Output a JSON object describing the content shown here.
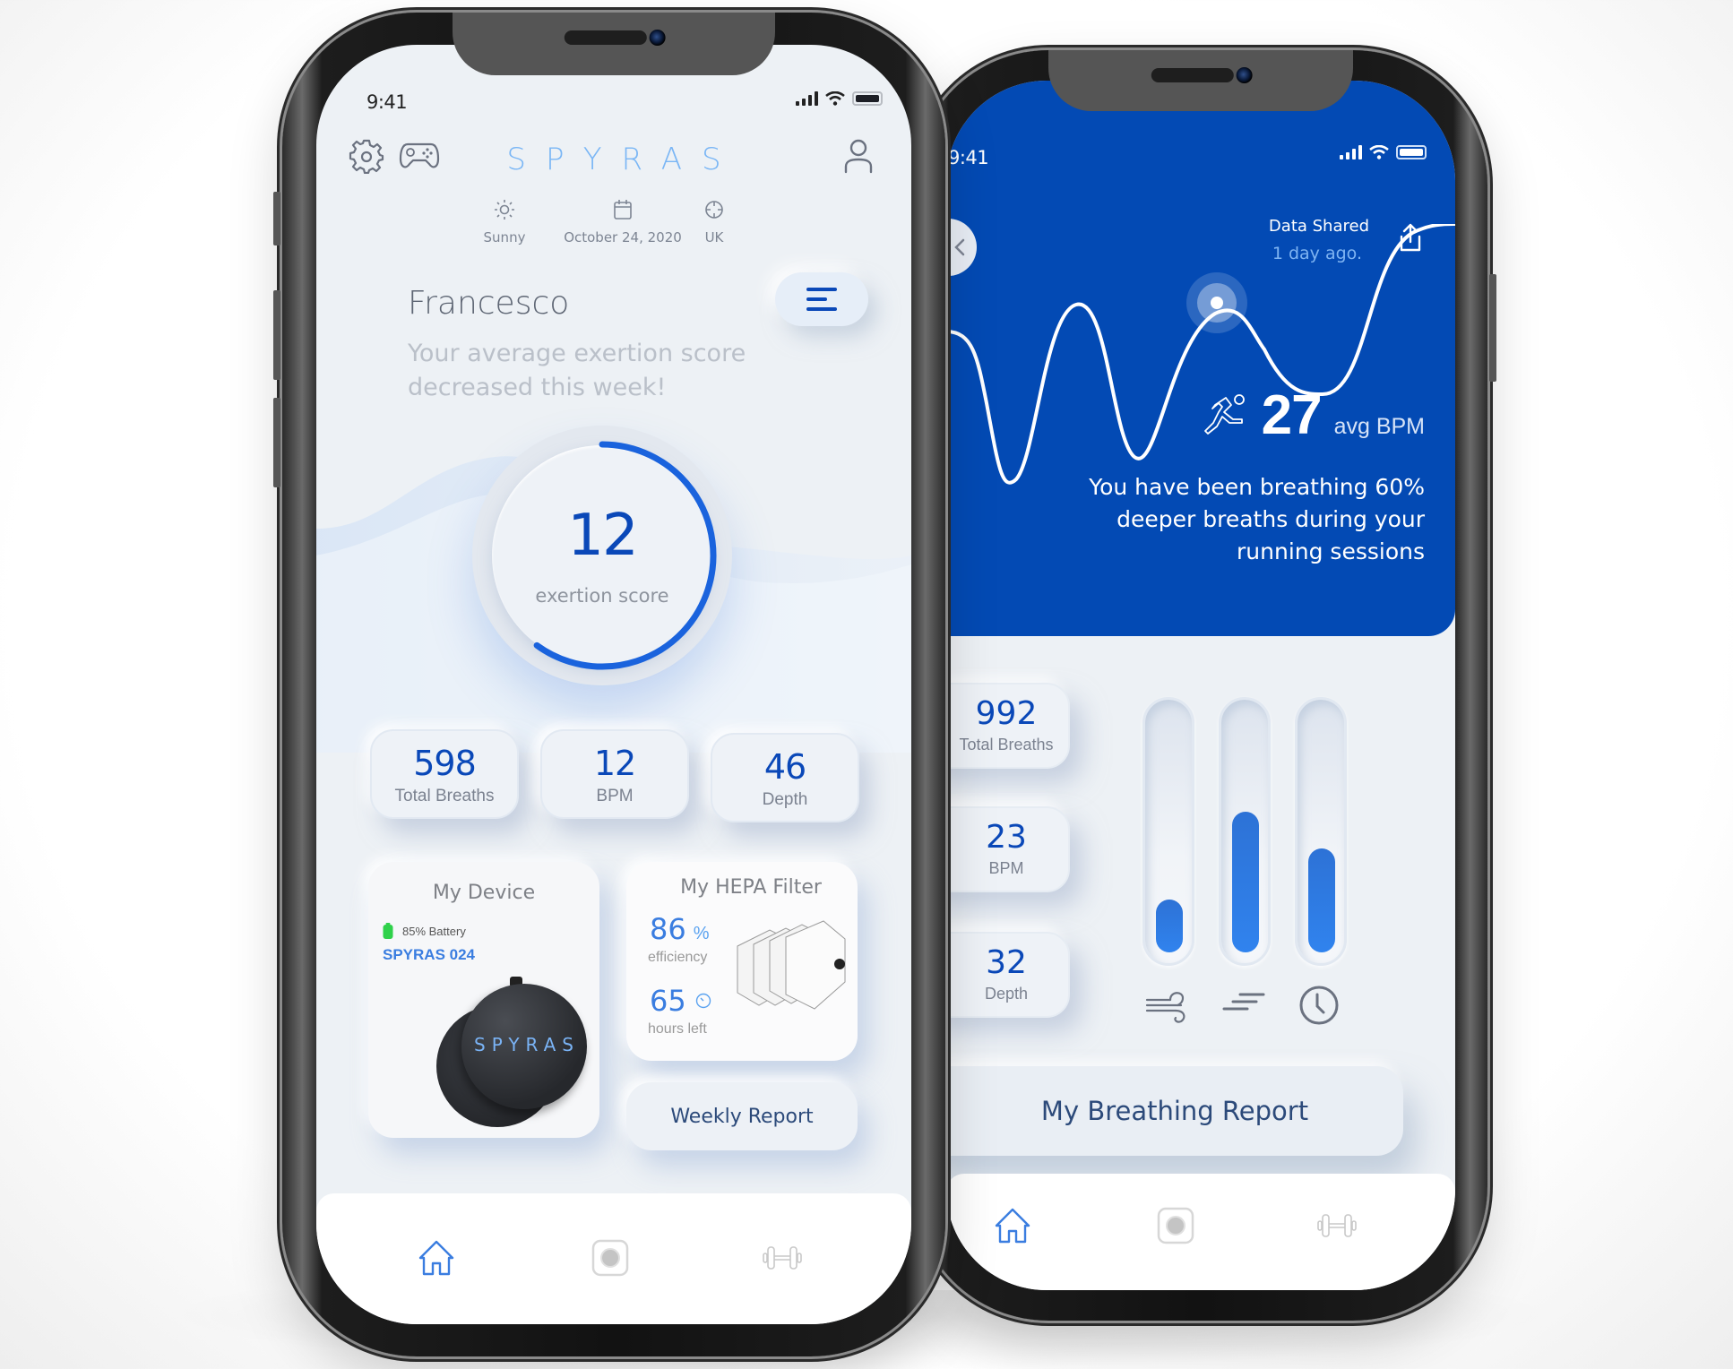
{
  "left_screen": {
    "status": {
      "time": "9:41"
    },
    "header": {
      "brand": "SPYRAS",
      "icons": [
        "gear-icon",
        "gamepad-icon",
        "user-icon"
      ]
    },
    "meta": {
      "weather": "Sunny",
      "date": "October 24, 2020",
      "location": "UK"
    },
    "greeting": {
      "name": "Francesco",
      "message": "Your average exertion score decreased this week!"
    },
    "exertion": {
      "value": "12",
      "label": "exertion score",
      "progress_fraction": 0.6
    },
    "stats": [
      {
        "value": "598",
        "label": "Total Breaths"
      },
      {
        "value": "12",
        "label": "BPM"
      },
      {
        "value": "46",
        "label": "Depth"
      }
    ],
    "device_card": {
      "title": "My Device",
      "battery": "85% Battery",
      "battery_level_percent": 85,
      "device_name": "SPYRAS 024",
      "device_logo": "SPYRAS"
    },
    "filter_card": {
      "title": "My HEPA Filter",
      "efficiency_value": "86",
      "efficiency_unit": "%",
      "efficiency_label": "efficiency",
      "hours_value": "65",
      "hours_label": "hours left"
    },
    "weekly_report_label": "Weekly Report",
    "tabs": [
      {
        "icon": "home-icon",
        "active": true
      },
      {
        "icon": "record-icon",
        "active": false
      },
      {
        "icon": "dumbbell-icon",
        "active": false
      }
    ]
  },
  "right_screen": {
    "status": {
      "time": "9:41"
    },
    "shared": {
      "title": "Data Shared",
      "subtitle": "1 day ago."
    },
    "bpm": {
      "value": "27",
      "unit": "avg BPM"
    },
    "insight": "You have been breathing 60% deeper breaths during your running sessions",
    "stats": [
      {
        "value": "992",
        "label": "Total Breaths"
      },
      {
        "value": "23",
        "label": "BPM"
      },
      {
        "value": "32",
        "label": "Depth"
      }
    ],
    "bars": [
      {
        "icon": "wind-icon",
        "level_fraction": 0.22
      },
      {
        "icon": "speed-lines-icon",
        "level_fraction": 0.58
      },
      {
        "icon": "clock-icon",
        "level_fraction": 0.43
      }
    ],
    "report_button": "My Breathing Report",
    "tabs": [
      {
        "icon": "home-icon",
        "active": true
      },
      {
        "icon": "record-icon",
        "active": false
      },
      {
        "icon": "dumbbell-icon",
        "active": false
      }
    ]
  },
  "colors": {
    "primary_blue": "#034ab4",
    "accent_blue": "#0a48b8",
    "brand_light_blue": "#7ab6f5",
    "battery_green": "#2fd14a"
  }
}
